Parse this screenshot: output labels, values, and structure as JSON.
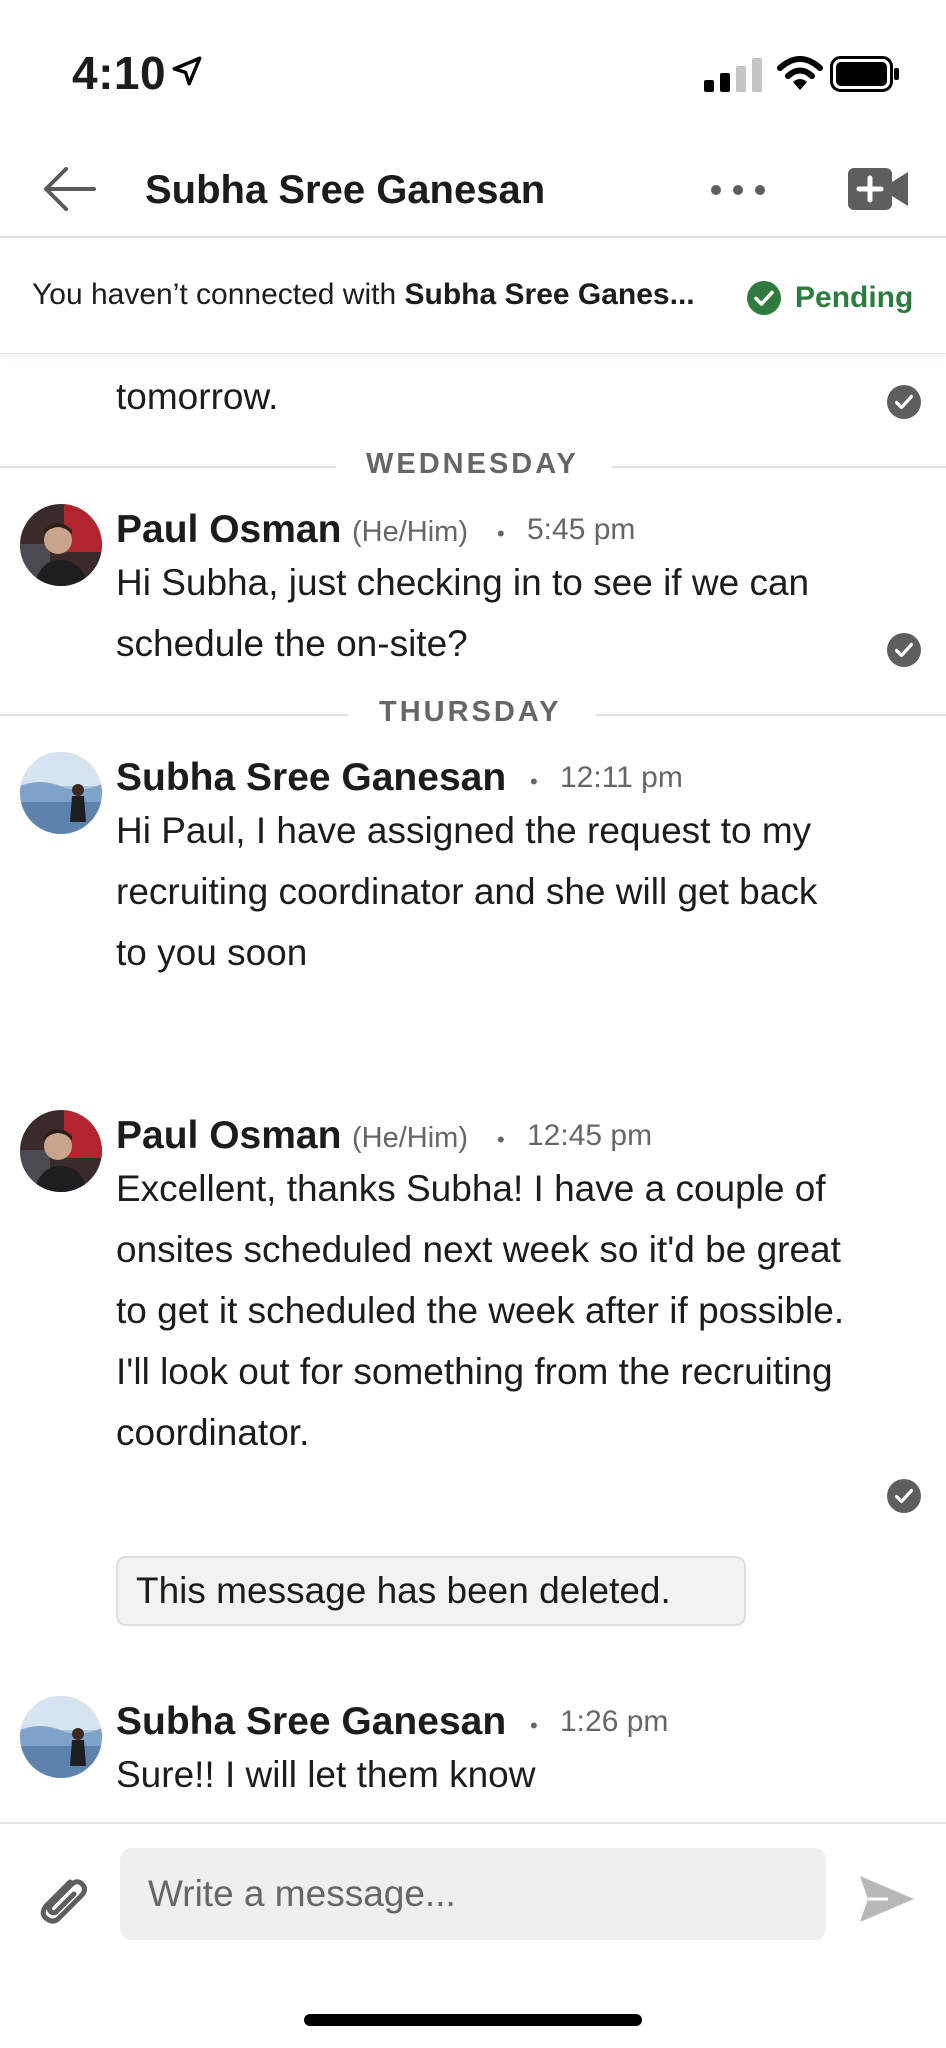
{
  "status_bar": {
    "time": "4:10"
  },
  "header": {
    "title": "Subha Sree Ganesan"
  },
  "banner": {
    "prefix": "You haven’t connected with ",
    "name": "Subha Sree Ganes...",
    "status": "Pending"
  },
  "messages": {
    "partial": {
      "text": "tomorrow."
    },
    "divider_wed": "WEDNESDAY",
    "m1": {
      "sender": "Paul Osman",
      "pronoun": "(He/Him)",
      "dot": "•",
      "time": "5:45 pm",
      "text": "Hi Subha, just checking in to see if we can schedule the on-site?"
    },
    "divider_thu": "THURSDAY",
    "m2": {
      "sender": "Subha Sree Ganesan",
      "dot": "•",
      "time": "12:11 pm",
      "text": "Hi Paul, I have assigned the request to my recruiting coordinator and she will get back to you soon"
    },
    "m3": {
      "sender": "Paul Osman",
      "pronoun": "(He/Him)",
      "dot": "•",
      "time": "12:45 pm",
      "text": "Excellent, thanks Subha! I have a couple of onsites scheduled next week so it'd be great to get it scheduled the week after if possible. I'll look out for something from the recruiting coordinator.",
      "deleted": "This message has been deleted."
    },
    "m4": {
      "sender": "Subha Sree Ganesan",
      "dot": "•",
      "time": "1:26 pm",
      "text": "Sure!! I will let them know"
    }
  },
  "composer": {
    "placeholder": "Write a message..."
  },
  "colors": {
    "pending_green": "#2f7b3f",
    "check_gray": "#5e5e5e"
  },
  "icons": [
    "location-arrow-icon",
    "signal-icon",
    "wifi-icon",
    "battery-icon",
    "back-arrow-icon",
    "more-icon",
    "video-call-icon",
    "check-circle-icon",
    "read-receipt-icon",
    "paperclip-icon",
    "send-icon"
  ]
}
